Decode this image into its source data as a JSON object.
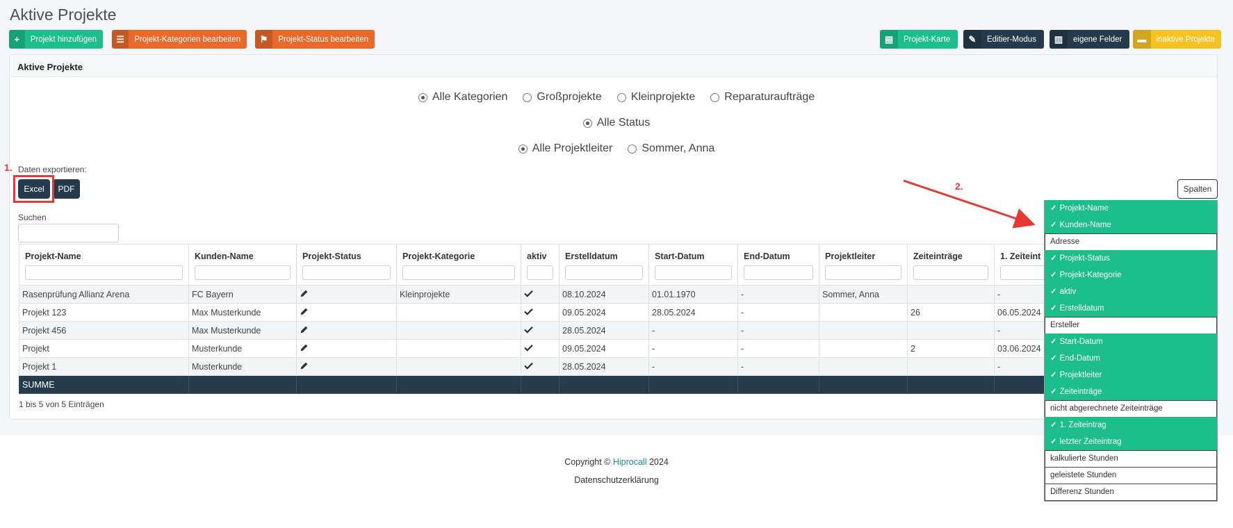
{
  "page": {
    "title": "Aktive Projekte"
  },
  "toolbar_left": [
    {
      "label": "Projekt hinzufügen",
      "icon": "plus-icon",
      "glyph": "+"
    },
    {
      "label": "Projekt-Kategorien bearbeiten",
      "icon": "list-icon",
      "glyph": "☰"
    },
    {
      "label": "Projekt-Status bearbeiten",
      "icon": "flag-icon",
      "glyph": "⚑"
    }
  ],
  "toolbar_right": [
    {
      "label": "Projekt-Karte",
      "icon": "map-icon",
      "glyph": "▤"
    },
    {
      "label": "Editier-Modus",
      "icon": "edit-icon",
      "glyph": "✎"
    },
    {
      "label": "eigene Felder",
      "icon": "columns-icon",
      "glyph": "▥"
    },
    {
      "label": "inaktive Projekte",
      "icon": "archive-icon",
      "glyph": "▬"
    }
  ],
  "card": {
    "title": "Aktive Projekte"
  },
  "filters": {
    "kategorien": [
      {
        "label": "Alle Kategorien",
        "checked": true
      },
      {
        "label": "Großprojekte",
        "checked": false
      },
      {
        "label": "Kleinprojekte",
        "checked": false
      },
      {
        "label": "Reparaturaufträge",
        "checked": false
      }
    ],
    "status": [
      {
        "label": "Alle Status",
        "checked": true
      }
    ],
    "projektleiter": [
      {
        "label": "Alle Projektleiter",
        "checked": true
      },
      {
        "label": "Sommer, Anna",
        "checked": false
      }
    ]
  },
  "annotations": {
    "step1": "1.",
    "step2": "2."
  },
  "export": {
    "label": "Daten exportieren:",
    "excel": "Excel",
    "pdf": "PDF"
  },
  "spalten": {
    "label": "Spalten"
  },
  "search": {
    "label": "Suchen",
    "value": ""
  },
  "table": {
    "columns": [
      "Projekt-Name",
      "Kunden-Name",
      "Projekt-Status",
      "Projekt-Kategorie",
      "aktiv",
      "Erstelldatum",
      "Start-Datum",
      "End-Datum",
      "Projektleiter",
      "Zeiteinträge",
      "1. Zeiteint"
    ],
    "rows": [
      [
        "Rasenprüfung Allianz Arena",
        "FC Bayern",
        "edit",
        "Kleinprojekte",
        "check",
        "08.10.2024",
        "01.01.1970",
        "-",
        "Sommer, Anna",
        "",
        "-"
      ],
      [
        "Projekt 123",
        "Max Musterkunde",
        "edit",
        "",
        "check",
        "09.05.2024",
        "28.05.2024",
        "-",
        "",
        "26",
        "06.05.2024"
      ],
      [
        "Projekt 456",
        "Max Musterkunde",
        "edit",
        "",
        "check",
        "28.05.2024",
        "-",
        "-",
        "",
        "",
        "-"
      ],
      [
        "Projekt",
        "Musterkunde",
        "edit",
        "",
        "check",
        "09.05.2024",
        "-",
        "-",
        "",
        "2",
        "03.06.2024"
      ],
      [
        "Projekt 1",
        "Musterkunde",
        "edit",
        "",
        "check",
        "28.05.2024",
        "-",
        "-",
        "",
        "",
        "-"
      ]
    ],
    "footer_label": "SUMME",
    "info": "1 bis 5 von 5 Einträgen"
  },
  "columns_dropdown": [
    {
      "label": "Projekt-Name",
      "checked": true
    },
    {
      "label": "Kunden-Name",
      "checked": true
    },
    {
      "label": "Adresse",
      "checked": false
    },
    {
      "label": "Projekt-Status",
      "checked": true
    },
    {
      "label": "Projekt-Kategorie",
      "checked": true
    },
    {
      "label": "aktiv",
      "checked": true
    },
    {
      "label": "Erstelldatum",
      "checked": true
    },
    {
      "label": "Ersteller",
      "checked": false
    },
    {
      "label": "Start-Datum",
      "checked": true
    },
    {
      "label": "End-Datum",
      "checked": true
    },
    {
      "label": "Projektleiter",
      "checked": true
    },
    {
      "label": "Zeiteinträge",
      "checked": true
    },
    {
      "label": "nicht abgerechnete Zeiteinträge",
      "checked": false
    },
    {
      "label": "1. Zeiteintrag",
      "checked": true
    },
    {
      "label": "letzter Zeiteintrag",
      "checked": true
    },
    {
      "label": "kalkulierte Stunden",
      "checked": false
    },
    {
      "label": "geleistete Stunden",
      "checked": false
    },
    {
      "label": "Differenz Stunden",
      "checked": false
    }
  ],
  "footer": {
    "copyright_prefix": "Copyright © ",
    "brand": "Hiprocall",
    "year": " 2024",
    "privacy": "Datenschutzerklärung"
  },
  "colors": {
    "green": "#1cbf8a",
    "orange": "#e8692a",
    "dark": "#253b4b",
    "yellow": "#f6c324",
    "annotation_red": "#e53935"
  }
}
